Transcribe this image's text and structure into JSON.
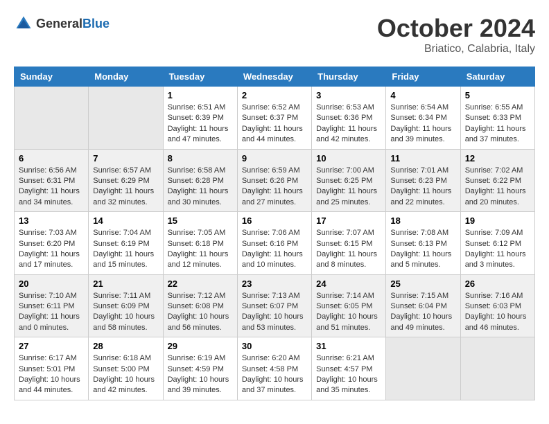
{
  "header": {
    "logo_general": "General",
    "logo_blue": "Blue",
    "title": "October 2024",
    "location": "Briatico, Calabria, Italy"
  },
  "days_of_week": [
    "Sunday",
    "Monday",
    "Tuesday",
    "Wednesday",
    "Thursday",
    "Friday",
    "Saturday"
  ],
  "weeks": [
    [
      {
        "day": "",
        "detail": ""
      },
      {
        "day": "",
        "detail": ""
      },
      {
        "day": "1",
        "detail": "Sunrise: 6:51 AM\nSunset: 6:39 PM\nDaylight: 11 hours and 47 minutes."
      },
      {
        "day": "2",
        "detail": "Sunrise: 6:52 AM\nSunset: 6:37 PM\nDaylight: 11 hours and 44 minutes."
      },
      {
        "day": "3",
        "detail": "Sunrise: 6:53 AM\nSunset: 6:36 PM\nDaylight: 11 hours and 42 minutes."
      },
      {
        "day": "4",
        "detail": "Sunrise: 6:54 AM\nSunset: 6:34 PM\nDaylight: 11 hours and 39 minutes."
      },
      {
        "day": "5",
        "detail": "Sunrise: 6:55 AM\nSunset: 6:33 PM\nDaylight: 11 hours and 37 minutes."
      }
    ],
    [
      {
        "day": "6",
        "detail": "Sunrise: 6:56 AM\nSunset: 6:31 PM\nDaylight: 11 hours and 34 minutes."
      },
      {
        "day": "7",
        "detail": "Sunrise: 6:57 AM\nSunset: 6:29 PM\nDaylight: 11 hours and 32 minutes."
      },
      {
        "day": "8",
        "detail": "Sunrise: 6:58 AM\nSunset: 6:28 PM\nDaylight: 11 hours and 30 minutes."
      },
      {
        "day": "9",
        "detail": "Sunrise: 6:59 AM\nSunset: 6:26 PM\nDaylight: 11 hours and 27 minutes."
      },
      {
        "day": "10",
        "detail": "Sunrise: 7:00 AM\nSunset: 6:25 PM\nDaylight: 11 hours and 25 minutes."
      },
      {
        "day": "11",
        "detail": "Sunrise: 7:01 AM\nSunset: 6:23 PM\nDaylight: 11 hours and 22 minutes."
      },
      {
        "day": "12",
        "detail": "Sunrise: 7:02 AM\nSunset: 6:22 PM\nDaylight: 11 hours and 20 minutes."
      }
    ],
    [
      {
        "day": "13",
        "detail": "Sunrise: 7:03 AM\nSunset: 6:20 PM\nDaylight: 11 hours and 17 minutes."
      },
      {
        "day": "14",
        "detail": "Sunrise: 7:04 AM\nSunset: 6:19 PM\nDaylight: 11 hours and 15 minutes."
      },
      {
        "day": "15",
        "detail": "Sunrise: 7:05 AM\nSunset: 6:18 PM\nDaylight: 11 hours and 12 minutes."
      },
      {
        "day": "16",
        "detail": "Sunrise: 7:06 AM\nSunset: 6:16 PM\nDaylight: 11 hours and 10 minutes."
      },
      {
        "day": "17",
        "detail": "Sunrise: 7:07 AM\nSunset: 6:15 PM\nDaylight: 11 hours and 8 minutes."
      },
      {
        "day": "18",
        "detail": "Sunrise: 7:08 AM\nSunset: 6:13 PM\nDaylight: 11 hours and 5 minutes."
      },
      {
        "day": "19",
        "detail": "Sunrise: 7:09 AM\nSunset: 6:12 PM\nDaylight: 11 hours and 3 minutes."
      }
    ],
    [
      {
        "day": "20",
        "detail": "Sunrise: 7:10 AM\nSunset: 6:11 PM\nDaylight: 11 hours and 0 minutes."
      },
      {
        "day": "21",
        "detail": "Sunrise: 7:11 AM\nSunset: 6:09 PM\nDaylight: 10 hours and 58 minutes."
      },
      {
        "day": "22",
        "detail": "Sunrise: 7:12 AM\nSunset: 6:08 PM\nDaylight: 10 hours and 56 minutes."
      },
      {
        "day": "23",
        "detail": "Sunrise: 7:13 AM\nSunset: 6:07 PM\nDaylight: 10 hours and 53 minutes."
      },
      {
        "day": "24",
        "detail": "Sunrise: 7:14 AM\nSunset: 6:05 PM\nDaylight: 10 hours and 51 minutes."
      },
      {
        "day": "25",
        "detail": "Sunrise: 7:15 AM\nSunset: 6:04 PM\nDaylight: 10 hours and 49 minutes."
      },
      {
        "day": "26",
        "detail": "Sunrise: 7:16 AM\nSunset: 6:03 PM\nDaylight: 10 hours and 46 minutes."
      }
    ],
    [
      {
        "day": "27",
        "detail": "Sunrise: 6:17 AM\nSunset: 5:01 PM\nDaylight: 10 hours and 44 minutes."
      },
      {
        "day": "28",
        "detail": "Sunrise: 6:18 AM\nSunset: 5:00 PM\nDaylight: 10 hours and 42 minutes."
      },
      {
        "day": "29",
        "detail": "Sunrise: 6:19 AM\nSunset: 4:59 PM\nDaylight: 10 hours and 39 minutes."
      },
      {
        "day": "30",
        "detail": "Sunrise: 6:20 AM\nSunset: 4:58 PM\nDaylight: 10 hours and 37 minutes."
      },
      {
        "day": "31",
        "detail": "Sunrise: 6:21 AM\nSunset: 4:57 PM\nDaylight: 10 hours and 35 minutes."
      },
      {
        "day": "",
        "detail": ""
      },
      {
        "day": "",
        "detail": ""
      }
    ]
  ]
}
